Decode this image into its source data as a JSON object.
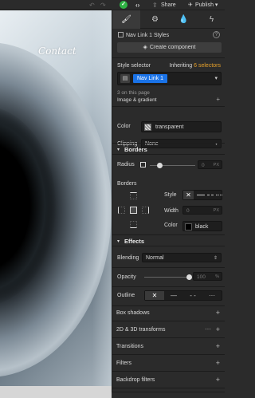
{
  "topbar": {
    "undo_icon": "↶",
    "redo_icon": "↷",
    "status_icon": "✓",
    "code_icon": "‹›",
    "share_icon": "⇪",
    "share_label": "Share",
    "publish_icon": "✈",
    "publish_label": "Publish ▾"
  },
  "canvas": {
    "brand_text": "Contact"
  },
  "panel": {
    "tabs": [
      {
        "name": "style",
        "icon": "🖌"
      },
      {
        "name": "settings",
        "icon": "⚙"
      },
      {
        "name": "color",
        "icon": "💧"
      },
      {
        "name": "interactions",
        "icon": "ϟ"
      }
    ],
    "selection_title": "Nav Link 1 Styles",
    "help_icon": "?",
    "create_component_icon": "◈",
    "create_component_label": "Create component",
    "style_selector_label": "Style selector",
    "inheriting_prefix": "Inheriting ",
    "inheriting_count": "6 selectors",
    "selector_icon": "▤",
    "selector_chip": "Nav Link 1",
    "selector_caret": "▾",
    "on_page": "3 on this page",
    "image_gradient_label": "Image & gradient",
    "color_label": "Color",
    "color_value": "transparent",
    "clipping_label": "Clipping",
    "clipping_value": "None",
    "borders_section": "Borders",
    "radius_label": "Radius",
    "radius_value": "0",
    "radius_unit": "PX",
    "borders_label": "Borders",
    "style_label": "Style",
    "width_label": "Width",
    "width_value": "0",
    "width_unit": "PX",
    "border_color_label": "Color",
    "border_color_value": "black",
    "effects_section": "Effects",
    "blending_label": "Blending",
    "blending_value": "Normal",
    "opacity_label": "Opacity",
    "opacity_value": "100",
    "opacity_unit": "%",
    "outline_label": "Outline",
    "box_shadows_label": "Box shadows",
    "transforms_label": "2D & 3D transforms",
    "transitions_label": "Transitions",
    "filters_label": "Filters",
    "backdrop_filters_label": "Backdrop filters",
    "plus_icon": "+",
    "more_icon": "···",
    "close_icon": "✕"
  }
}
